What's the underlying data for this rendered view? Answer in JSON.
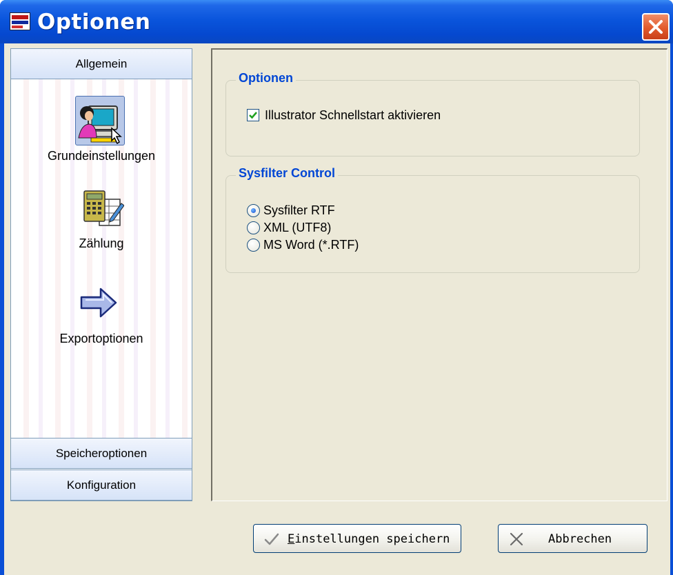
{
  "window": {
    "title": "Optionen"
  },
  "nav": {
    "sections": {
      "general": "Allgemein",
      "storage": "Speicheroptionen",
      "configuration": "Konfiguration"
    },
    "items": [
      {
        "label": "Grundeinstellungen",
        "icon": "user-computer-icon",
        "selected": true
      },
      {
        "label": "Zählung",
        "icon": "calculator-icon",
        "selected": false
      },
      {
        "label": "Exportoptionen",
        "icon": "export-arrow-icon",
        "selected": false
      }
    ]
  },
  "options_group": {
    "legend": "Optionen",
    "checkbox_label": "Illustrator Schnellstart aktivieren",
    "checkbox_checked": true
  },
  "sysfilter_group": {
    "legend": "Sysfilter Control",
    "radios": [
      {
        "label": "Sysfilter RTF",
        "checked": true
      },
      {
        "label": "XML (UTF8)",
        "checked": false
      },
      {
        "label": "MS Word (*.RTF)",
        "checked": false
      }
    ]
  },
  "buttons": {
    "save_mnemonic": "E",
    "save_rest": "instellungen speichern",
    "cancel": "Abbrechen"
  },
  "colors": {
    "titlebar": "#0548cf",
    "close": "#e25a2c",
    "legend": "#0046d5",
    "dialog_bg": "#ece9d8"
  }
}
